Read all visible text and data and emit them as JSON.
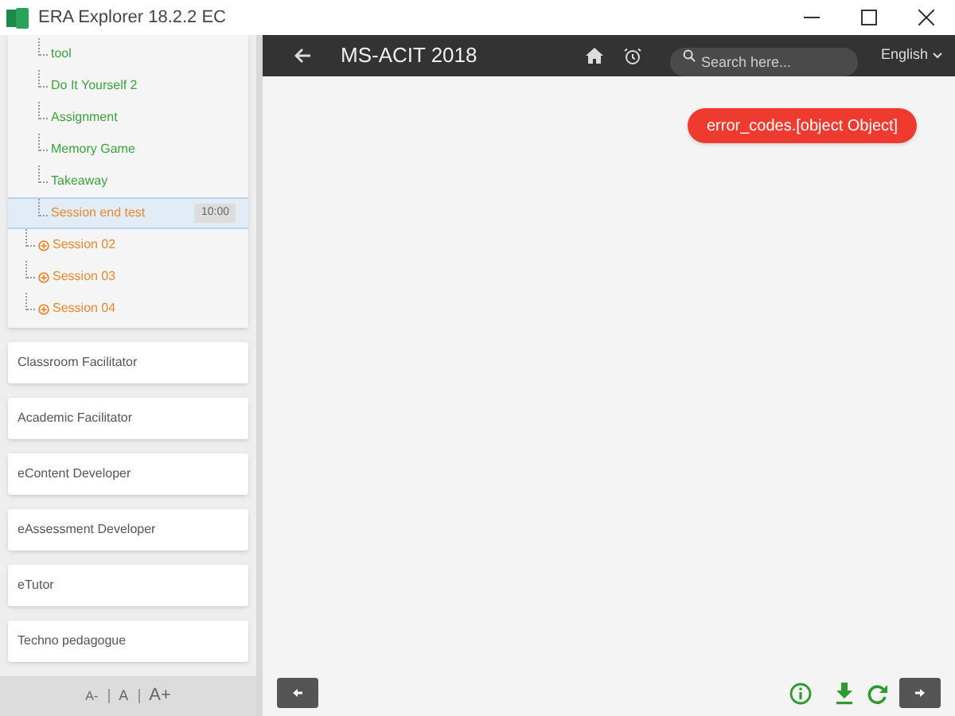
{
  "window": {
    "title": "ERA Explorer 18.2.2 EC"
  },
  "tree": {
    "items": [
      {
        "label": "tool",
        "kind": "activity",
        "selected": false
      },
      {
        "label": "Do It Yourself 2",
        "kind": "activity",
        "selected": false
      },
      {
        "label": "Assignment",
        "kind": "activity",
        "selected": false
      },
      {
        "label": "Memory Game",
        "kind": "activity",
        "selected": false
      },
      {
        "label": "Takeaway",
        "kind": "activity",
        "selected": false
      },
      {
        "label": "Session end test",
        "kind": "test",
        "selected": true,
        "duration": "10:00"
      }
    ],
    "sessions": [
      {
        "label": "Session 02",
        "expanded": false
      },
      {
        "label": "Session 03",
        "expanded": false
      },
      {
        "label": "Session 04",
        "expanded": false
      }
    ]
  },
  "roles": [
    "Classroom Facilitator",
    "Academic Facilitator",
    "eContent Developer",
    "eAssessment Developer",
    "eTutor",
    "Techno pedagogue"
  ],
  "font_controls": [
    "A-",
    "A",
    "A+"
  ],
  "header": {
    "title": "MS-ACIT 2018",
    "search": {
      "placeholder": "Search here..."
    },
    "language": "English"
  },
  "error_toast": "error_codes.[object Object]"
}
